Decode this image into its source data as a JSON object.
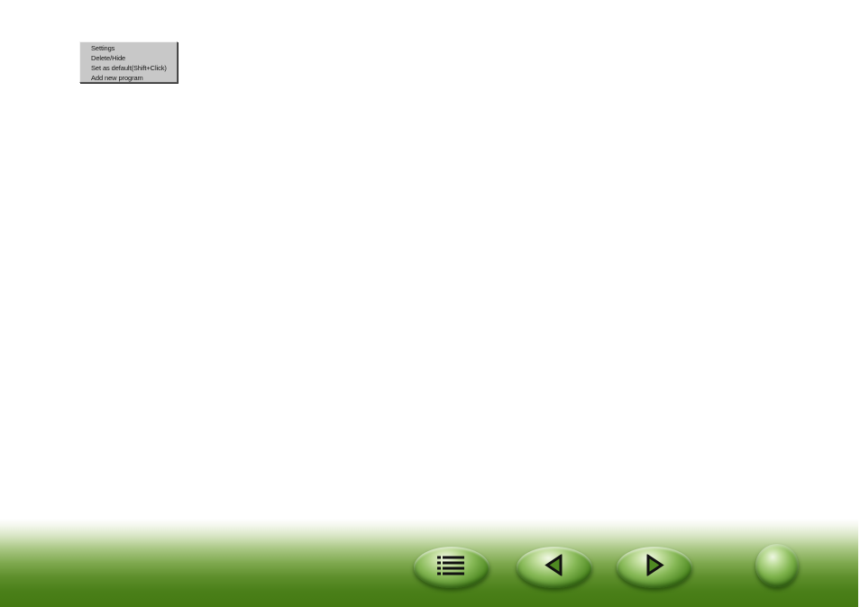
{
  "context_menu": {
    "items": [
      {
        "label": "Settings"
      },
      {
        "label": "Delete/Hide"
      },
      {
        "label": "Set as default(Shift+Click)"
      },
      {
        "label": "Add new program"
      }
    ]
  },
  "nav_bar": {
    "buttons": [
      {
        "icon": "list-icon"
      },
      {
        "icon": "arrow-left-icon"
      },
      {
        "icon": "arrow-right-icon"
      },
      {
        "icon": "circle-button"
      }
    ]
  },
  "colors": {
    "menu_background": "#c8c8c8",
    "nav_green_dark": "#447a12",
    "nav_green_light": "#a9c784"
  }
}
